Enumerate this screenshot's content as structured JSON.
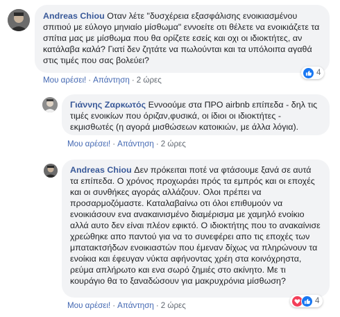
{
  "comments": [
    {
      "author": "Andreas Chiou",
      "text": "Οταν λέτε \"δυσχέρεια εξασφάλισης ενοικιασμένου σπιτιού με εύλογο μηνιαίο μίσθωμα\" εννοείτε οτι θέλετε να ενοικιάζετε τα σπίτια μας με μίσθωμα που θα ορίζετε εσείς και οχι οι ιδιοκτήτες, αν κατάλαβα καλά? Γιατί δεν ζητάτε να πωλούνται και τα υπόλοιπα αγαθά στις τιμές που σας βολεύει?",
      "like": "Μου αρέσει!",
      "reply": "Απάντηση",
      "time": "2 ώρες",
      "reaction_count": "4",
      "reaction_icons": [
        "like-icon"
      ]
    },
    {
      "author": "Γιάννης Ζαρκωτός",
      "text": "Εννοούμε στα ΠΡΟ airbnb επίπεδα - δηλ τις τιμές ενοικίων που όριζαν,φυσικά, οι ίδιοι οι ιδιοκτήτες - εκμισθωτές (η αγορά μισθώσεων κατοικιών, με άλλα λόγια).",
      "like": "Μου αρέσει!",
      "reply": "Απάντηση",
      "time": "2 ώρες"
    },
    {
      "author": "Andreas Chiou",
      "text": "Δεν πρόκειται ποτέ να φτάσουμε ξανά σε αυτά τα επίπεδα. Ο χρόνος προχωράει πρός τα εμπρός και οι εποχές και οι συνθήκες αγοράς αλλάζουν. Ολοι πρέπει να προσαρμοζόμαστε. Καταλαβαίνω οτι όλοι επιθυμούν να ενοικιάσουν ενα ανακαινισμένο διαμέρισμα με χαμηλό ενοίκιο αλλά αυτο δεν είναι πλέον εφικτό. Ο ιδιοκτήτης που το ανακαίνισε χρεώθηκε απο παντού για να το συνεφέρει απο τις εποχές των μπατακτσήδων ενοικιαστών που έμεναν δίχως να πληρώνουν τα ενοίκια και έφευγαν νύκτα αφήνοντας χρέη στα κοινόχρηστα, ρεύμα απλήρωτο και ενα σωρό ζημιές στο ακίνητο. Με τι κουράγιο θα το ξαναδώσουν για μακρυχρόνια μίσθωση?",
      "like": "Μου αρέσει!",
      "reply": "Απάντηση",
      "time": "2 ώρες",
      "reaction_count": "4",
      "reaction_icons": [
        "love-icon",
        "like-icon"
      ]
    }
  ],
  "colors": {
    "author": "#385898",
    "link": "#4267b2",
    "bubble": "#f2f3f5",
    "like": "#1877f2",
    "love": "#f33e58"
  }
}
